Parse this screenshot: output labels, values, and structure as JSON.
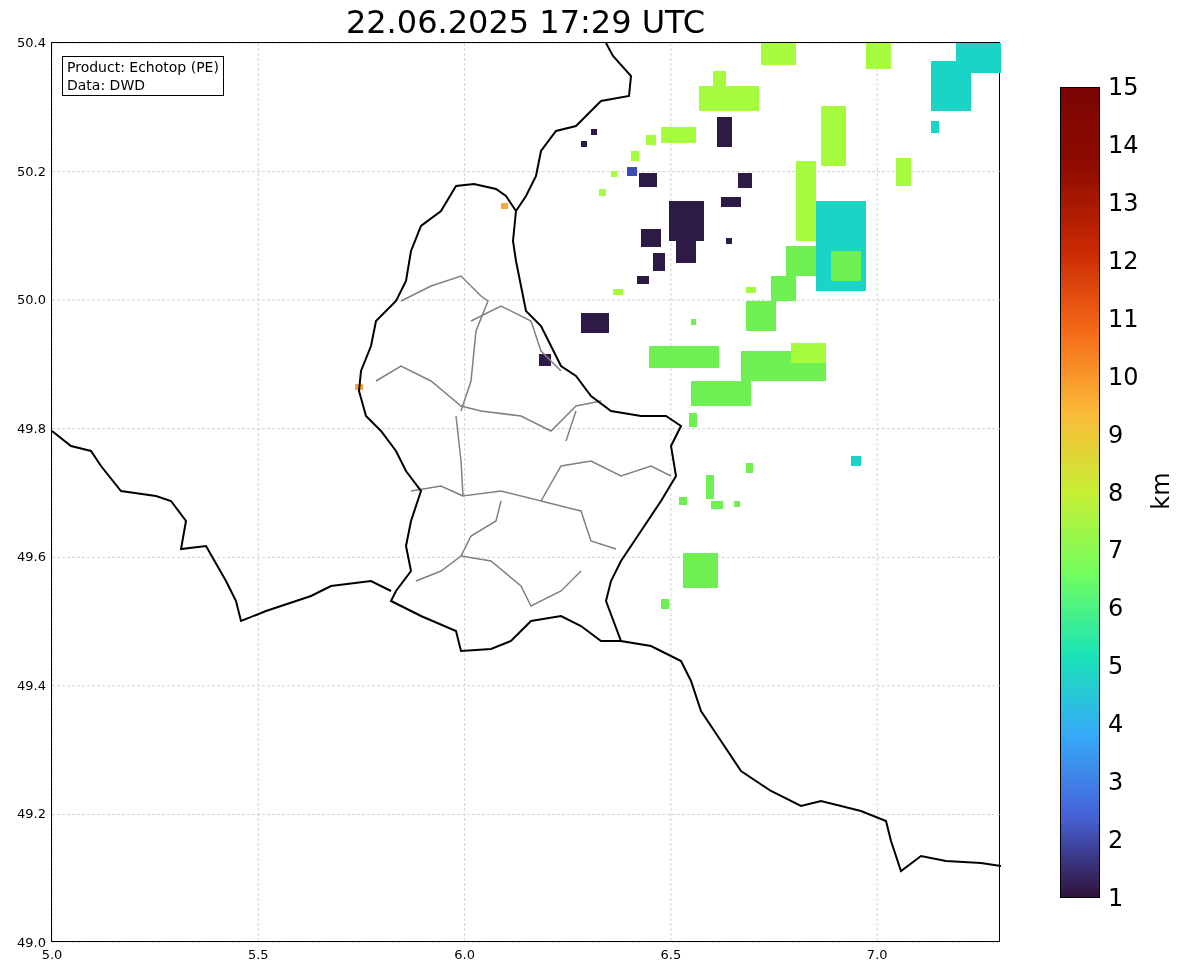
{
  "title": "22.06.2025 17:29 UTC",
  "map": {
    "info_box": [
      "Product: Echotop (PE)",
      "Data: DWD"
    ],
    "y_tick_labels": [
      "50.4",
      "50.2",
      "50.0",
      "49.8",
      "49.6",
      "49.4",
      "49.2",
      "49.0"
    ],
    "x_tick_labels": [
      "5.0",
      "5.5",
      "6.0",
      "6.5",
      "7.0"
    ]
  },
  "colorbar": {
    "label": "km",
    "ticks": [
      "15",
      "14",
      "13",
      "12",
      "11",
      "10",
      "9",
      "8",
      "7",
      "6",
      "5",
      "4",
      "3",
      "2",
      "1"
    ]
  }
}
